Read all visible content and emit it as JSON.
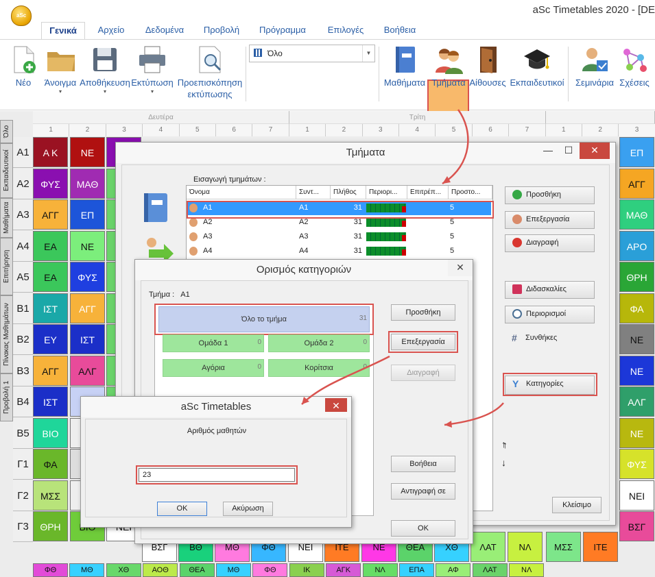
{
  "app": {
    "title": "aSc Timetables 2020  - [DE"
  },
  "menu_tabs": [
    "Γενικά",
    "Αρχείο",
    "Δεδομένα",
    "Προβολή",
    "Πρόγραμμα",
    "Επιλογές",
    "Βοήθεια"
  ],
  "ribbon": {
    "new": "Νέο",
    "open": "Άνοιγμα",
    "save": "Αποθήκευση",
    "print": "Εκτύπωση",
    "preview_1": "Προεπισκόπηση",
    "preview_2": "εκτύπωσης",
    "view_select": "Όλο",
    "subjects": "Μαθήματα",
    "classes": "Τμήματα",
    "rooms": "Αίθουσες",
    "teachers": "Εκπαιδευτικοί",
    "seminars": "Σεμινάρια",
    "relations": "Σχέσεις"
  },
  "side_tabs": [
    "Όλο",
    "Εκπαιδευτικοί",
    "Μαθήματα",
    "Επιτήρηση",
    "Πίνακας Μαθημάτων",
    "Προβολή 1"
  ],
  "grid": {
    "days": [
      "Δευτέρα",
      "Τρίτη"
    ],
    "periods": [
      "1",
      "2",
      "3",
      "4",
      "5",
      "6",
      "7",
      "1",
      "2",
      "3",
      "4",
      "5",
      "6",
      "7",
      "1",
      "2",
      "3"
    ],
    "rows": [
      "Α1",
      "Α2",
      "Α3",
      "Α4",
      "Α5",
      "Β1",
      "Β2",
      "Β3",
      "Β4",
      "Β5",
      "Γ1",
      "Γ2",
      "Γ3"
    ],
    "col1": [
      "Α Κ",
      "ΦΥΣ",
      "ΑΓΓ",
      "ΕΑ",
      "ΕΑ",
      "ΙΣΤ",
      "ΕΥ",
      "ΑΓΓ",
      "ΙΣΤ",
      "ΒΙΟ",
      "ΦΑ",
      "ΜΣΣ",
      "ΘΡΗ"
    ],
    "col2": [
      "ΝΕ",
      "ΜΑΘ",
      "ΕΠ",
      "ΝΕ",
      "ΦΥΣ",
      "ΑΓΓ",
      "ΙΣΤ",
      "ΑΛΓ",
      "",
      "",
      "Ν",
      "Α",
      "ΒΙΟ"
    ],
    "col3_partial": [
      "",
      "",
      "",
      "Μ",
      "",
      "",
      "",
      "Χ",
      "",
      "",
      "",
      "",
      "ΝΕΙ"
    ],
    "right_col": [
      "ΕΠ",
      "ΑΓΓ",
      "ΜΑΘ",
      "ΑΡΟ",
      "ΘΡΗ",
      "ΦΑ",
      "ΝΕ",
      "ΝΕ",
      "ΑΛΓ",
      "ΝΕ",
      "ΦΥΣ",
      "ΝΕΙ",
      "ΒΣΓ"
    ],
    "bottom_row": [
      "ΒΣΓ",
      "ΒΘ",
      "ΜΘ",
      "ΦΘ",
      "ΝΕΙ",
      "ΙΤΕ",
      "ΝΕ",
      "ΘΕΑ",
      "ΧΘ",
      "ΛΑΤ",
      "ΝΛ",
      "ΜΣΣ",
      "ΙΤΕ"
    ],
    "bottom_row2": [
      "ΦΘ",
      "ΜΘ",
      "ΧΘ",
      "ΑΟΘ",
      "ΘΕΑ",
      "ΜΘ",
      "ΦΘ",
      "ΙΚ",
      "ΑΓΚ",
      "ΝΛ",
      "ΕΠΑ",
      "ΑΦ",
      "ΛΑΤ",
      "ΝΛ"
    ]
  },
  "dlg_classes": {
    "title": "Τμήματα",
    "import_label": "Εισαγωγή τμημάτων :",
    "columns": [
      "Όνομα",
      "Συντ...",
      "Πλήθος",
      "Περιορι...",
      "Επιτρέπ...",
      "Προστο..."
    ],
    "rows": [
      {
        "name": "Α1",
        "short": "Α1",
        "count": "31",
        "extra": "5"
      },
      {
        "name": "Α2",
        "short": "Α2",
        "count": "31",
        "extra": "5"
      },
      {
        "name": "Α3",
        "short": "Α3",
        "count": "31",
        "extra": "5"
      },
      {
        "name": "Α4",
        "short": "Α4",
        "count": "31",
        "extra": "5"
      }
    ],
    "buttons": {
      "add": "Προσθήκη",
      "edit": "Επεξεργασία",
      "delete": "Διαγραφή",
      "lessons": "Διδασκαλίες",
      "limits": "Περιορισμοί",
      "conditions": "Συνθήκες",
      "categories": "Κατηγορίες",
      "close": "Κλείσιμο"
    }
  },
  "dlg_categories": {
    "title": "Ορισμός κατηγοριών",
    "class_label": "Τμήμα :",
    "class_value": "Α1",
    "whole": {
      "label": "Όλο το τμήμα",
      "count": "31"
    },
    "groups": [
      {
        "label": "Ομάδα 1",
        "count": "0"
      },
      {
        "label": "Ομάδα 2",
        "count": "0"
      },
      {
        "label": "Αγόρια",
        "count": "0"
      },
      {
        "label": "Κορίτσια",
        "count": "0"
      }
    ],
    "buttons": {
      "add": "Προσθήκη",
      "edit": "Επεξεργασία",
      "delete": "Διαγραφή",
      "help": "Βοήθεια",
      "copy": "Αντιγραφή σε",
      "ok": "ΟΚ"
    },
    "up_arrow": "↑",
    "down_arrow": "↓"
  },
  "dlg_input": {
    "title": "aSc Timetables",
    "prompt": "Αριθμός μαθητών",
    "value": "23",
    "ok": "OK",
    "cancel": "Ακύρωση"
  }
}
